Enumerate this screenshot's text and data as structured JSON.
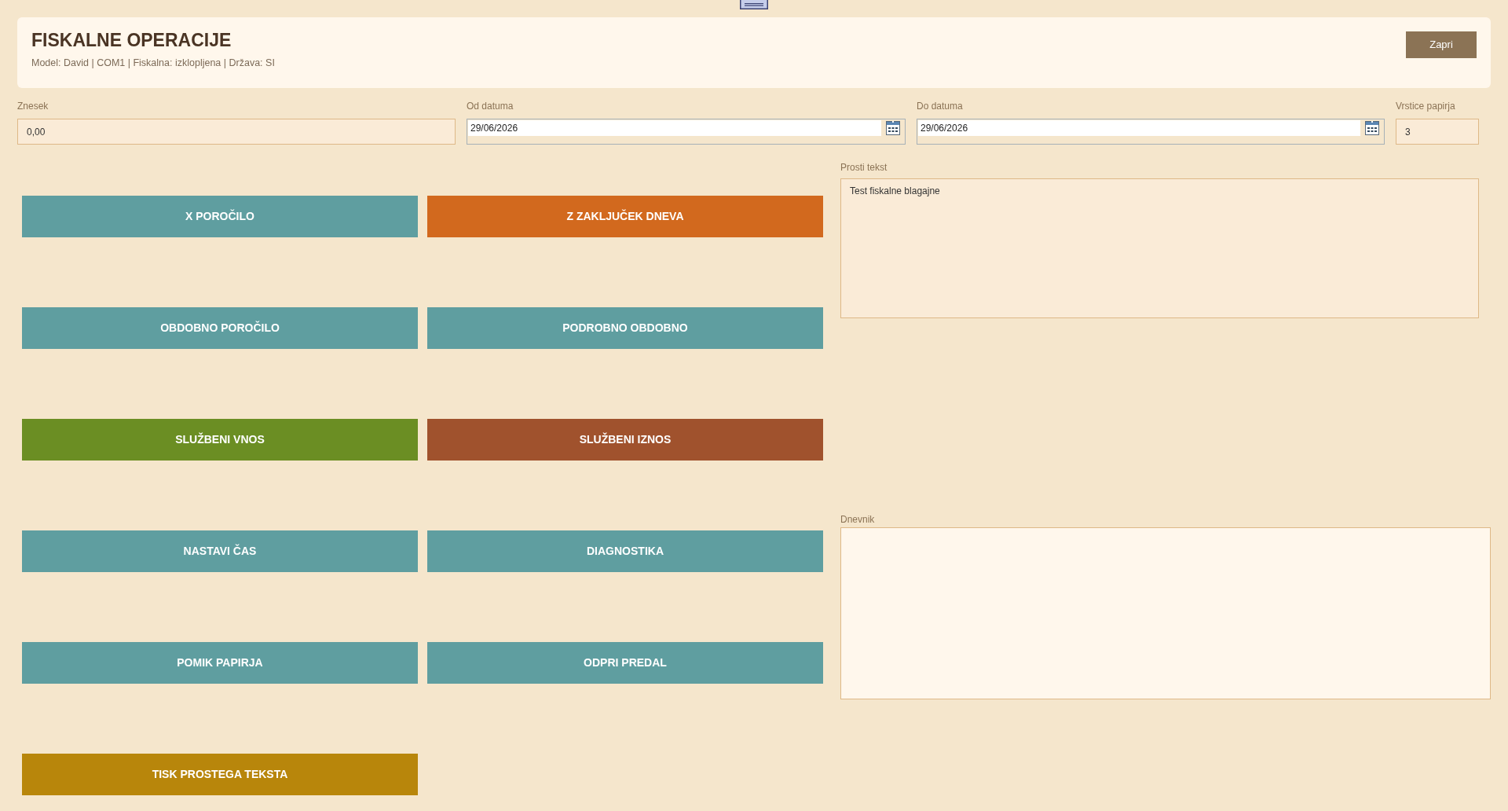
{
  "header": {
    "title": "FISKALNE OPERACIJE",
    "subtitle": "Model: David | COM1 | Fiskalna: izklopljena | Država: SI",
    "close_button": "Zapri"
  },
  "fields": [
    {
      "kind": "text",
      "label": "Znesek",
      "value": "0,00"
    },
    {
      "kind": "date",
      "label": "Od datuma",
      "value": "29/06/2026"
    },
    {
      "kind": "date",
      "label": "Do datuma",
      "value": "29/06/2026"
    },
    {
      "kind": "text",
      "label": "Vrstice papirja",
      "value": "3"
    }
  ],
  "operations": [
    {
      "label": "X POROČILO",
      "color": "#5f9ea0"
    },
    {
      "label": "Z ZAKLJUČEK DNEVA",
      "color": "#d2691e"
    },
    {
      "label": "OBDOBNO POROČILO",
      "color": "#5f9ea0"
    },
    {
      "label": "PODROBNO OBDOBNO",
      "color": "#5f9ea0"
    },
    {
      "label": "SLUŽBENI VNOS",
      "color": "#6b8e23"
    },
    {
      "label": "SLUŽBENI IZNOS",
      "color": "#a0522d"
    },
    {
      "label": "NASTAVI ČAS",
      "color": "#5f9ea0"
    },
    {
      "label": "DIAGNOSTIKA",
      "color": "#5f9ea0"
    },
    {
      "label": "POMIK PAPIRJA",
      "color": "#5f9ea0"
    },
    {
      "label": "ODPRI PREDAL",
      "color": "#5f9ea0"
    },
    {
      "label": "TISK PROSTEGA TEKSTA",
      "color": "#b8860b"
    }
  ],
  "plain_text": {
    "label": "Prosti tekst",
    "value": "Test fiskalne blagajne"
  },
  "log": {
    "label": "Dnevnik"
  }
}
